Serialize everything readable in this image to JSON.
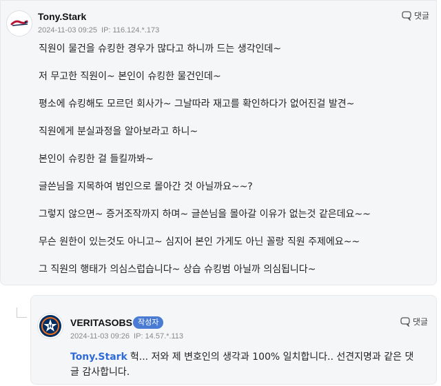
{
  "comment": {
    "author": "Tony.Stark",
    "date": "2024-11-03 09:25",
    "ip": "IP: 116.124.*.173",
    "reply_label": "댓글",
    "avatar_icon": "braves-logo-icon",
    "lines": [
      "직원이 물건을 슈킹한 경우가 많다고 하니까 드는 생각인데~",
      "저 무고한 직원이~ 본인이 슈킹한 물건인데~",
      "평소에 슈킹해도 모르던 회사가~ 그날따라 재고를 확인하다가 없어진걸 발견~",
      "직원에게 분실과정을 알아보라고 하니~",
      "본인이 슈킹한 걸 들킬까봐~",
      "글쓴님을 지목하여 범인으로 몰아간 것 아닐까요~~?",
      "그렇지 않으면~ 증거조작까지 하며~ 글쓴님을 몰아갈 이유가 없는것 같은데요~~",
      "무슨 원한이 있는것도 아니고~ 심지어 본인 가게도 아닌 꼴랑 직원 주제에요~~",
      "그 직원의 행태가 의심스럽습니다~ 상습 슈킹범 아닐까 의심됩니다~"
    ]
  },
  "reply": {
    "author": "VERITASOBS",
    "badge": "작성자",
    "date": "2024-11-03 09:26",
    "ip": "IP: 14.57.*.113",
    "reply_label": "댓글",
    "avatar_icon": "astros-logo-icon",
    "mention": "Tony.Stark",
    "text_line1": "헉... 저와 제 변호인의 생각과 100% 일치합니다.. 선견지명과 같은 댓",
    "text_line2": "글 감사합니다."
  },
  "colors": {
    "card_bg": "#f5f6f8",
    "mention": "#2f6bd8",
    "badge_bg": "#4a7bd4"
  }
}
